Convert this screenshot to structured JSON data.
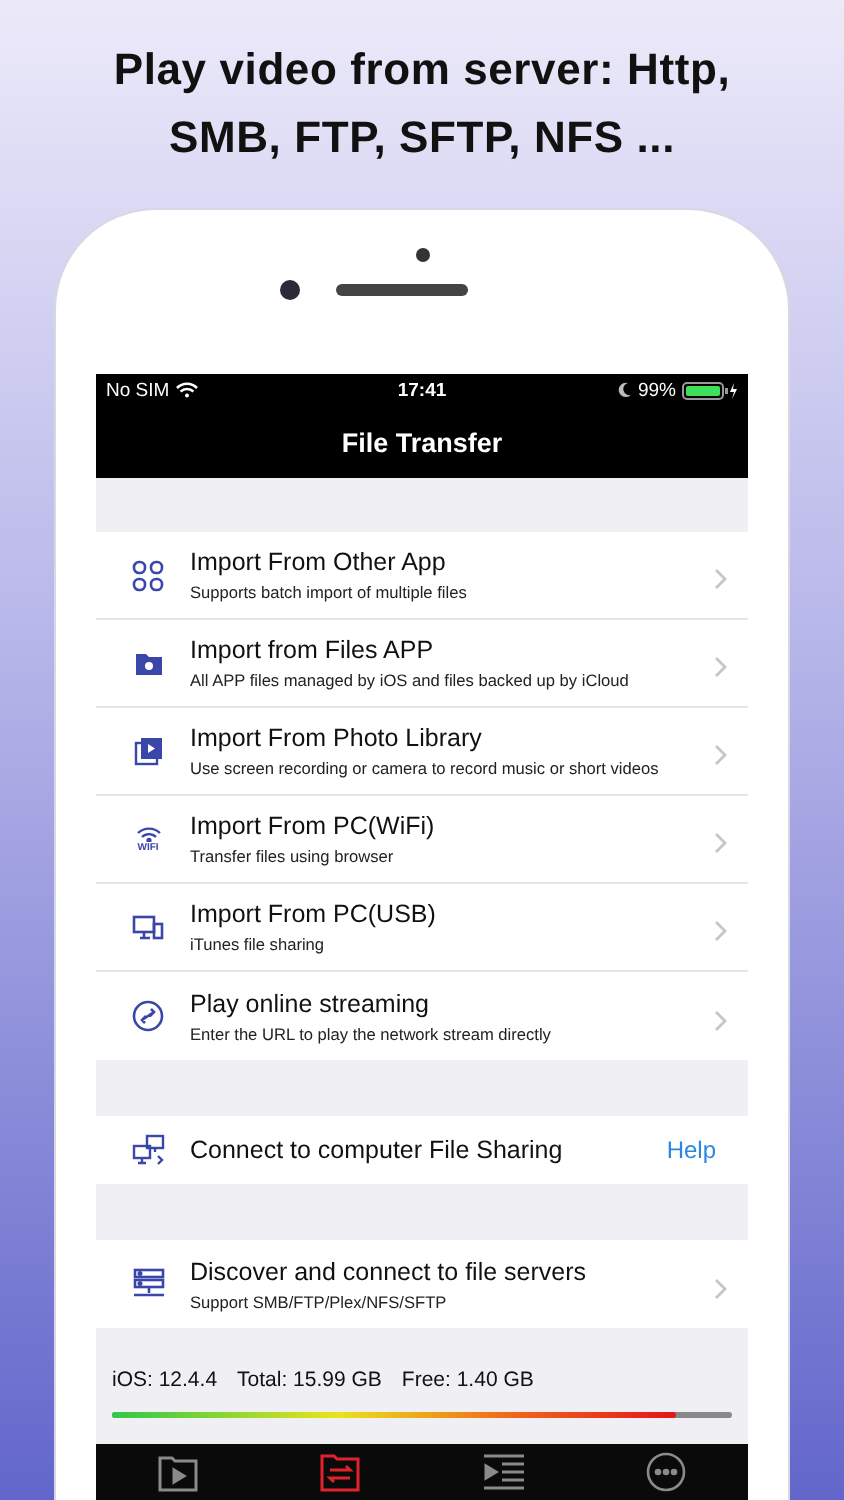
{
  "headline": "Play video from server: Http, SMB, FTP, SFTP, NFS ...",
  "status_bar": {
    "carrier": "No SIM",
    "time": "17:41",
    "battery": "99%"
  },
  "nav_bar": {
    "title": "File Transfer"
  },
  "sections": [
    {
      "rows": [
        {
          "kind": "apps",
          "title": "Import From Other App",
          "subtitle": "Supports batch import of multiple files"
        },
        {
          "kind": "folder",
          "title": "Import from Files APP",
          "subtitle": "All APP files managed by iOS and files backed up by iCloud"
        },
        {
          "kind": "video",
          "title": "Import From Photo Library",
          "subtitle": "Use screen recording or camera to record music or short videos"
        },
        {
          "kind": "wifi",
          "title": "Import From PC(WiFi)",
          "subtitle": "Transfer files using browser",
          "icon_text": "WIFI"
        },
        {
          "kind": "usb",
          "title": "Import From PC(USB)",
          "subtitle": "iTunes file sharing"
        },
        {
          "kind": "link",
          "title": "Play online streaming",
          "subtitle": "Enter the URL to play the network stream directly"
        }
      ]
    },
    {
      "rows": [
        {
          "kind": "share",
          "title": "Connect to computer File Sharing",
          "action": "Help"
        }
      ]
    },
    {
      "rows": [
        {
          "kind": "server",
          "title": "Discover and connect to file servers",
          "subtitle": "Support SMB/FTP/Plex/NFS/SFTP"
        }
      ]
    }
  ],
  "storage": {
    "ios": "iOS: 12.4.4",
    "total": "Total: 15.99 GB",
    "free": "Free: 1.40 GB",
    "level": 0.91
  },
  "tab_bar": [
    {
      "kind": "player",
      "selected": false
    },
    {
      "kind": "transfer",
      "selected": true
    },
    {
      "kind": "playlist",
      "selected": false
    },
    {
      "kind": "more",
      "selected": false
    }
  ]
}
